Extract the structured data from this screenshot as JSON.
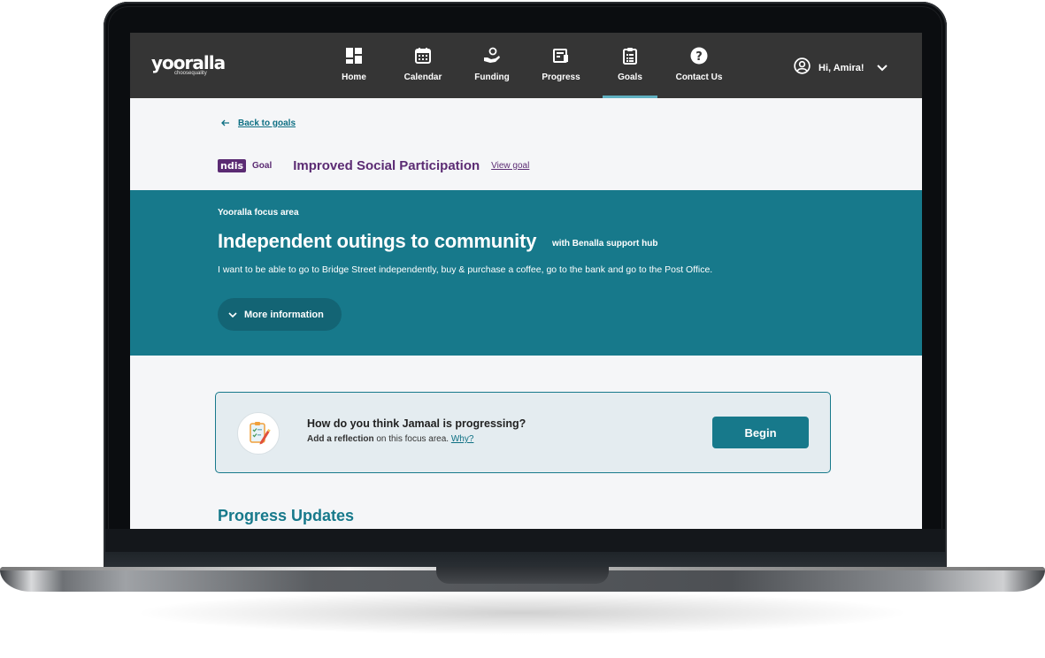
{
  "brand": {
    "logo_text": "yooralla",
    "tagline": "choosequality"
  },
  "nav": {
    "items": [
      {
        "label": "Home",
        "icon": "home-grid-icon",
        "active": false
      },
      {
        "label": "Calendar",
        "icon": "calendar-icon",
        "active": false
      },
      {
        "label": "Funding",
        "icon": "funding-hand-icon",
        "active": false
      },
      {
        "label": "Progress",
        "icon": "progress-report-icon",
        "active": false
      },
      {
        "label": "Goals",
        "icon": "clipboard-icon",
        "active": true
      },
      {
        "label": "Contact Us",
        "icon": "help-circle-icon",
        "active": false
      }
    ],
    "user_greeting": "Hi, Amira!"
  },
  "breadcrumb": {
    "back_label": "Back to goals"
  },
  "goal": {
    "badge": "ndis",
    "tag": "Goal",
    "title": "Improved Social Participation",
    "view_link": "View goal"
  },
  "focus": {
    "eyebrow": "Yooralla focus area",
    "title": "Independent outings to community",
    "provider": "with Benalla support hub",
    "description": "I want to be able to go to Bridge Street independently, buy & purchase a coffee, go to the bank and go to the Post Office.",
    "more_button": "More information"
  },
  "reflection": {
    "question": "How do you think Jamaal is progressing?",
    "hint_bold": "Add a reflection",
    "hint_rest": " on this focus area.",
    "why_link": "Why?",
    "begin_button": "Begin"
  },
  "updates": {
    "heading": "Progress Updates"
  },
  "colors": {
    "nav_bg": "#353535",
    "teal": "#17798b",
    "teal_dark": "#136474",
    "ndis_purple": "#5b2b73",
    "card_bg": "#e4ecf0"
  }
}
